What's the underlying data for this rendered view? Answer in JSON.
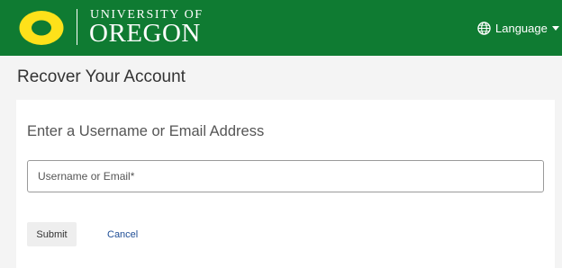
{
  "colors": {
    "brand_green": "#0f7b32",
    "brand_yellow": "#fee11a",
    "link_blue": "#1f4e96"
  },
  "header": {
    "logo_icon": "oregon-o-logo",
    "wordmark_top": "UNIVERSITY OF",
    "wordmark_bottom": "OREGON",
    "language": {
      "icon": "globe-icon",
      "label": "Language",
      "caret_icon": "caret-down-icon"
    }
  },
  "page": {
    "title": "Recover Your Account"
  },
  "form": {
    "heading": "Enter a Username or Email Address",
    "username_field": {
      "placeholder": "Username or Email*",
      "value": ""
    },
    "submit_label": "Submit",
    "cancel_label": "Cancel"
  }
}
